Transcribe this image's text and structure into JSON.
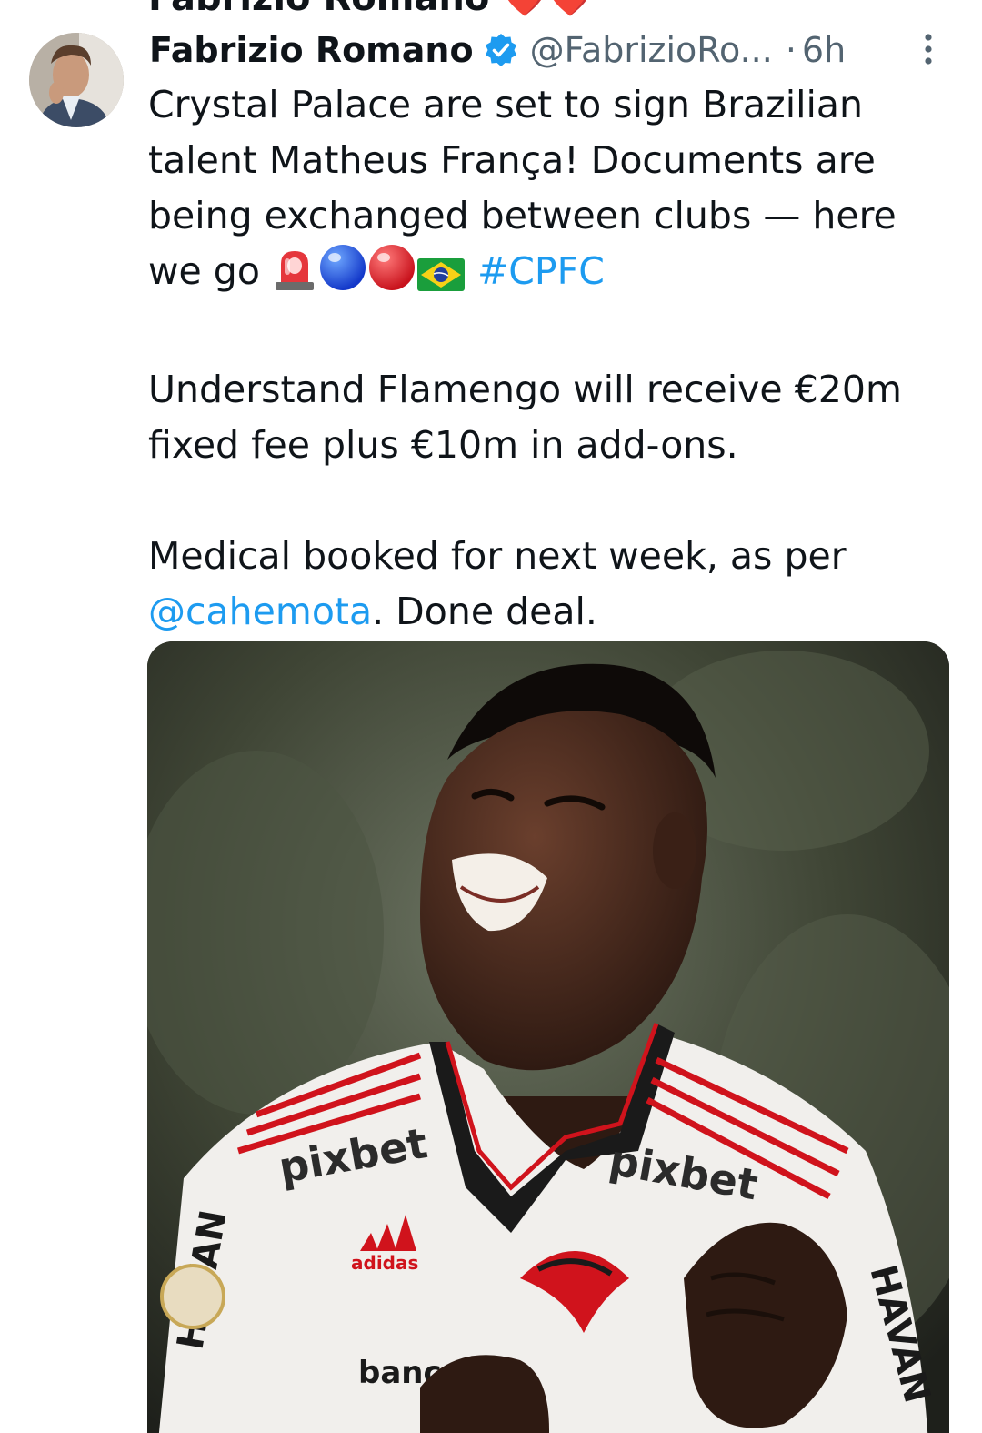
{
  "previous_tweet": {
    "clipped_text": "Fabrizio Romano ❤️❤️"
  },
  "tweet": {
    "display_name": "Fabrizio Romano",
    "handle": "@FabrizioRo...",
    "separator": "·",
    "time": "6h",
    "line1_text": "Crystal Palace are set to sign Brazilian talent Matheus França! Documents are being exchanged between clubs — here we go ",
    "emojis": [
      "siren-emoji",
      "blue-circle-emoji",
      "red-circle-emoji",
      "brazil-flag-emoji"
    ],
    "hashtag": "#CPFC",
    "paragraph2": "Understand Flamengo will receive €20m fixed fee plus €10m in add-ons.",
    "paragraph3_before": "Medical booked for next week, as per ",
    "mention": "@cahemota",
    "paragraph3_after": ". Done deal.",
    "image": {
      "shirt_sponsor": "pixbet",
      "kit_brand": "adidas",
      "sleeve_text": "HAVAN",
      "bottom_text": "banc"
    }
  },
  "colors": {
    "text": "#0f1419",
    "secondary": "#536471",
    "link": "#1d9bf0",
    "verified": "#1d9bf0"
  },
  "icons": {
    "verified": "verified-badge-icon",
    "more": "more-vertical-icon"
  }
}
